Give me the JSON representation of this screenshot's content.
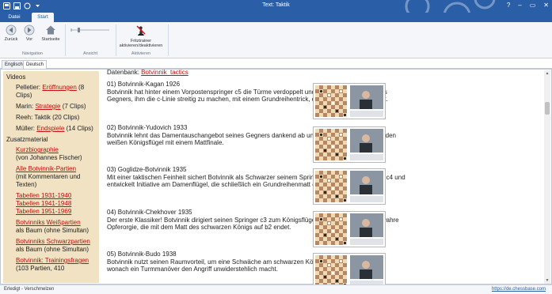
{
  "window": {
    "title": "Text: Taktik",
    "controls": [
      "?",
      "–",
      "▭",
      "✕"
    ]
  },
  "ribbon": {
    "tabs": [
      {
        "label": "Datei"
      },
      {
        "label": "Start"
      }
    ],
    "back_label": "Zurück",
    "forward_label": "Vor",
    "home_label": "Startseite",
    "nav_group_label": "Navigation",
    "view_group_label": "Ansicht",
    "fritz_label_line1": "Fritztrainer",
    "fritz_label_line2": "aktivieren/deaktivieren",
    "activate_group_label": "Aktivieren"
  },
  "language_tabs": [
    {
      "label": "Englisch"
    },
    {
      "label": "Deutsch"
    }
  ],
  "sidebar": {
    "videos_heading": "Videos",
    "video_items": [
      {
        "prefix": "Pelletier: ",
        "link": "Eröffnungen",
        "suffix": " (8 Clips)"
      },
      {
        "prefix": "Marin: ",
        "link": "Strategie",
        "suffix": " (7 Clips)"
      },
      {
        "prefix": "Reeh: Taktik (20 Clips)",
        "link": "",
        "suffix": ""
      },
      {
        "prefix": "Müller: ",
        "link": "Endspiele",
        "suffix": " (14 Clips)"
      }
    ],
    "extra_heading": "Zusatzmaterial",
    "extra_items": [
      {
        "link": "Kurzbiographie",
        "text": "(von Johannes Fischer)"
      },
      {
        "link": "Alle Botvinnik-Partien",
        "text": "(mit Kommentaren und Texten)"
      },
      {
        "links": [
          "Tabellen 1931-1940",
          "Tabellen 1941-1948",
          "Tabellen 1951-1969"
        ]
      },
      {
        "link": "Botvinniks Weißpartien",
        "text": "als Baum (ohne Simultan)"
      },
      {
        "link": "Botvinniks Schwarzpartien",
        "text": "als Baum (ohne Simultan)"
      },
      {
        "link": "Botvinnik: Trainingsfragen",
        "text": "(103 Partien, 410"
      }
    ]
  },
  "content": {
    "db_prefix": "Datenbank: ",
    "db_link": "Botvinnik_tactics",
    "entries": [
      {
        "title": "01) Botvinnik-Kagan 1926",
        "text": "Botvinnik hat hinter einem Vorpostenspringer c5 die Türme verdoppelt und bestraft den Versuch des Gegners, ihm die c-Linie streitig zu machen, mit einem Grundreihentrick, der zu Bauerngewinn führt."
      },
      {
        "title": "02) Botvinnik-Yudovich 1933",
        "text": "Botvinnik lehnt das Damentauschangebot seines Gegners dankend ab und krönt seinen Angriff auf den weißen Königsflügel mit einem Mattfinale."
      },
      {
        "title": "03) Goglidze-Botvinnik 1935",
        "text": "Mit einer taktischen Feinheit sichert Botvinnik als Schwarzer seinem Springer a5 das Vorpostenfeld c4 und entwickelt Initiative am Damenflügel, die schließlich ein Grundreihenmatt ermöglicht."
      },
      {
        "title": "04) Botvinnik-Chekhover 1935",
        "text": "Der erste Klassiker! Botvinnik dirigiert seinen Springer c3 zum Königsflügel und entfacht dort eine wahre Opferorgie, die mit dem Matt des schwarzen Königs auf b2 endet."
      },
      {
        "title": "05) Botvinnik-Budo 1938",
        "text": "Botvinnik nutzt seinen Raumvorteil, um eine Schwäche am schwarzen Königsflügel zu provozieren, wonach ein Turmmanöver den Angriff unwiderstehlich macht."
      }
    ]
  },
  "statusbar": {
    "left_text": "Erledigt - Verschmelzen",
    "right_link": "https://de.chessbase.com"
  },
  "colors": {
    "titlebar": "#2a5fa8",
    "sidebar_bg": "#f0e2c2",
    "link": "#c01010",
    "board_light": "#f0d9b5",
    "board_dark": "#b58863"
  }
}
